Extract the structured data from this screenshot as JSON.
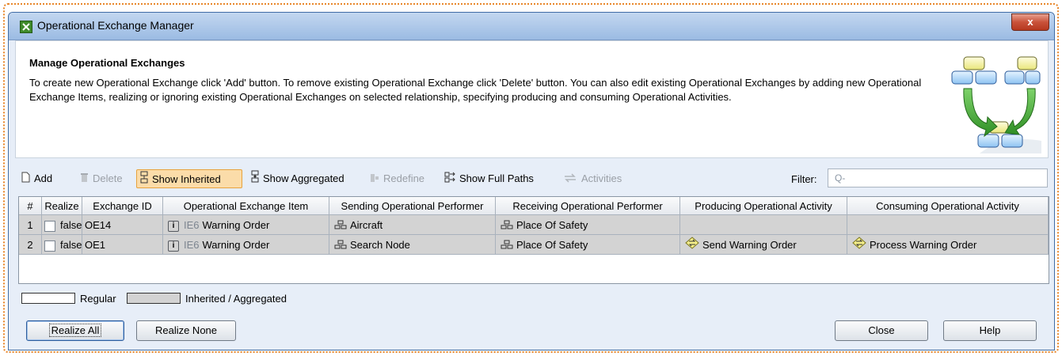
{
  "window": {
    "title": "Operational Exchange Manager",
    "close_label": "x"
  },
  "header": {
    "title": "Manage Operational Exchanges",
    "description": "To create new Operational Exchange click 'Add' button. To remove existing Operational Exchange click 'Delete' button. You can also edit existing Operational Exchanges by adding new Operational Exchange Items, realizing or ignoring existing Operational Exchanges on selected relationship, specifying producing and consuming Operational Activities."
  },
  "toolbar": {
    "add": "Add",
    "delete": "Delete",
    "show_inherited": "Show Inherited",
    "show_aggregated": "Show Aggregated",
    "redefine": "Redefine",
    "show_full_paths": "Show Full Paths",
    "activities": "Activities",
    "filter_label": "Filter:",
    "filter_placeholder": "Q-"
  },
  "table": {
    "columns": [
      "#",
      "Realize",
      "Exchange ID",
      "Operational Exchange Item",
      "Sending Operational Performer",
      "Receiving Operational Performer",
      "Producing Operational Activity",
      "Consuming Operational Activity"
    ],
    "rows": [
      {
        "num": "1",
        "realize": "false",
        "exchange_id": "OE14",
        "item_id": "IE6",
        "item_name": "Warning Order",
        "sending": "Aircraft",
        "receiving": "Place Of Safety",
        "producing": "",
        "consuming": ""
      },
      {
        "num": "2",
        "realize": "false",
        "exchange_id": "OE1",
        "item_id": "IE6",
        "item_name": "Warning Order",
        "sending": "Search Node",
        "receiving": "Place Of Safety",
        "producing": "Send Warning Order",
        "consuming": "Process Warning Order"
      }
    ]
  },
  "legend": {
    "regular": "Regular",
    "inherited": "Inherited / Aggregated"
  },
  "buttons": {
    "realize_all": "Realize All",
    "realize_none": "Realize None",
    "close": "Close",
    "help": "Help"
  },
  "colors": {
    "inherited_row": "#d3d3d3",
    "active_toggle": "#fbdca9",
    "frame_accent": "#e8862a"
  }
}
